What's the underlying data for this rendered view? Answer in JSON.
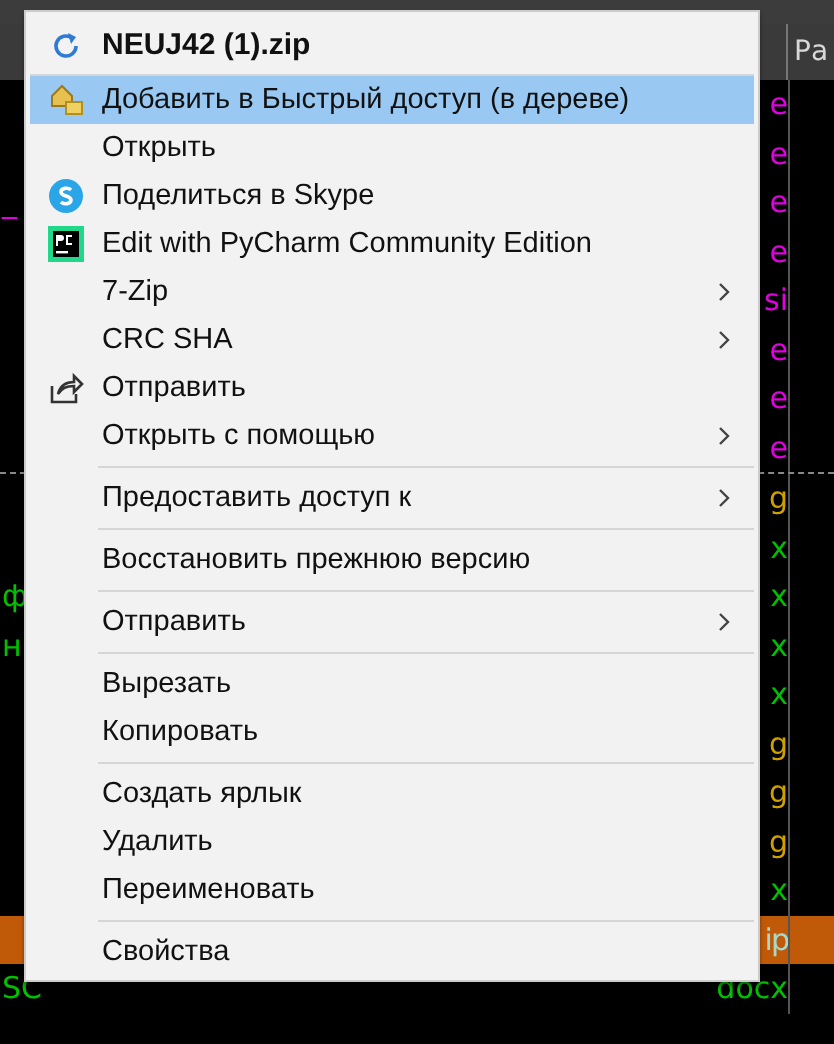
{
  "panel": {
    "header": "Ра",
    "rows": [
      {
        "right": "e",
        "color": "#e000e0",
        "selected": false,
        "dashed": false
      },
      {
        "right": "e",
        "color": "#e000e0",
        "selected": false,
        "dashed": false
      },
      {
        "left": "_",
        "right": "e",
        "color": "#e000e0",
        "selected": false,
        "dashed": false
      },
      {
        "right": "e",
        "color": "#e000e0",
        "selected": false,
        "dashed": false
      },
      {
        "right": "si",
        "color": "#e000e0",
        "selected": false,
        "dashed": false
      },
      {
        "right": "e",
        "color": "#e000e0",
        "selected": false,
        "dashed": false
      },
      {
        "right": "e",
        "color": "#e000e0",
        "selected": false,
        "dashed": false
      },
      {
        "right": "e",
        "color": "#e000e0",
        "selected": false,
        "dashed": true
      },
      {
        "right": "g",
        "color": "#d0a000",
        "selected": false,
        "dashed": false
      },
      {
        "right": "x",
        "color": "#00c000",
        "selected": false,
        "dashed": false
      },
      {
        "left": "ф",
        "right": "x",
        "color": "#00c000",
        "selected": false,
        "dashed": false
      },
      {
        "left": "н",
        "right": "x",
        "color": "#00c000",
        "selected": false,
        "dashed": false
      },
      {
        "right": "x",
        "color": "#00c000",
        "selected": false,
        "dashed": false
      },
      {
        "right": "g",
        "color": "#d0a000",
        "selected": false,
        "dashed": false
      },
      {
        "right": "g",
        "color": "#d0a000",
        "selected": false,
        "dashed": false
      },
      {
        "right": "g",
        "color": "#d0a000",
        "selected": false,
        "dashed": false
      },
      {
        "right": "x",
        "color": "#00c000",
        "selected": false,
        "dashed": false
      },
      {
        "right": "ip",
        "color": "#a8d8c8",
        "selected": true,
        "dashed": false
      },
      {
        "left": "SC",
        "right": "docx",
        "color": "#00c000",
        "selected": false,
        "dashed": false
      }
    ]
  },
  "menu": {
    "title": "NEUJ42 (1).zip",
    "items": [
      {
        "kind": "item",
        "label": "Добавить в Быстрый доступ (в дереве)",
        "selected": true,
        "submenu": false
      },
      {
        "kind": "item",
        "label": "Открыть",
        "selected": false,
        "submenu": false
      },
      {
        "kind": "item",
        "label": "Поделиться в Skype",
        "selected": false,
        "submenu": false
      },
      {
        "kind": "item",
        "label": "Edit with PyCharm Community Edition",
        "selected": false,
        "submenu": false
      },
      {
        "kind": "item",
        "label": "7-Zip",
        "selected": false,
        "submenu": true
      },
      {
        "kind": "item",
        "label": "CRC SHA",
        "selected": false,
        "submenu": true
      },
      {
        "kind": "item",
        "label": "Отправить",
        "selected": false,
        "submenu": false
      },
      {
        "kind": "item",
        "label": "Открыть с помощью",
        "selected": false,
        "submenu": true
      },
      {
        "kind": "separator"
      },
      {
        "kind": "item",
        "label": "Предоставить доступ к",
        "selected": false,
        "submenu": true
      },
      {
        "kind": "separator"
      },
      {
        "kind": "item",
        "label": "Восстановить прежнюю версию",
        "selected": false,
        "submenu": false
      },
      {
        "kind": "separator"
      },
      {
        "kind": "item",
        "label": "Отправить",
        "selected": false,
        "submenu": true
      },
      {
        "kind": "separator"
      },
      {
        "kind": "item",
        "label": "Вырезать",
        "selected": false,
        "submenu": false
      },
      {
        "kind": "item",
        "label": "Копировать",
        "selected": false,
        "submenu": false
      },
      {
        "kind": "separator"
      },
      {
        "kind": "item",
        "label": "Создать ярлык",
        "selected": false,
        "submenu": false
      },
      {
        "kind": "item",
        "label": "Удалить",
        "selected": false,
        "submenu": false
      },
      {
        "kind": "item",
        "label": "Переименовать",
        "selected": false,
        "submenu": false
      },
      {
        "kind": "separator"
      },
      {
        "kind": "item",
        "label": "Свойства",
        "selected": false,
        "submenu": false
      }
    ]
  }
}
